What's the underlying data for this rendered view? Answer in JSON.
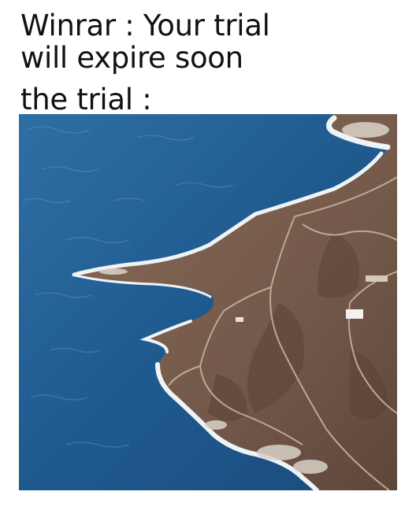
{
  "meme": {
    "caption_line_1": "Winrar : Your trial",
    "caption_line_2": "will expire soon",
    "caption_line_3": "the trial :"
  },
  "image": {
    "subject": "aerial-coastline-photo",
    "colors": {
      "sea_deep": "#1c4f82",
      "sea_mid": "#2b6a9e",
      "surf": "#e9eef2",
      "land": "#7a5e4c",
      "land_dark": "#5e4639",
      "road": "#b9a791"
    }
  }
}
